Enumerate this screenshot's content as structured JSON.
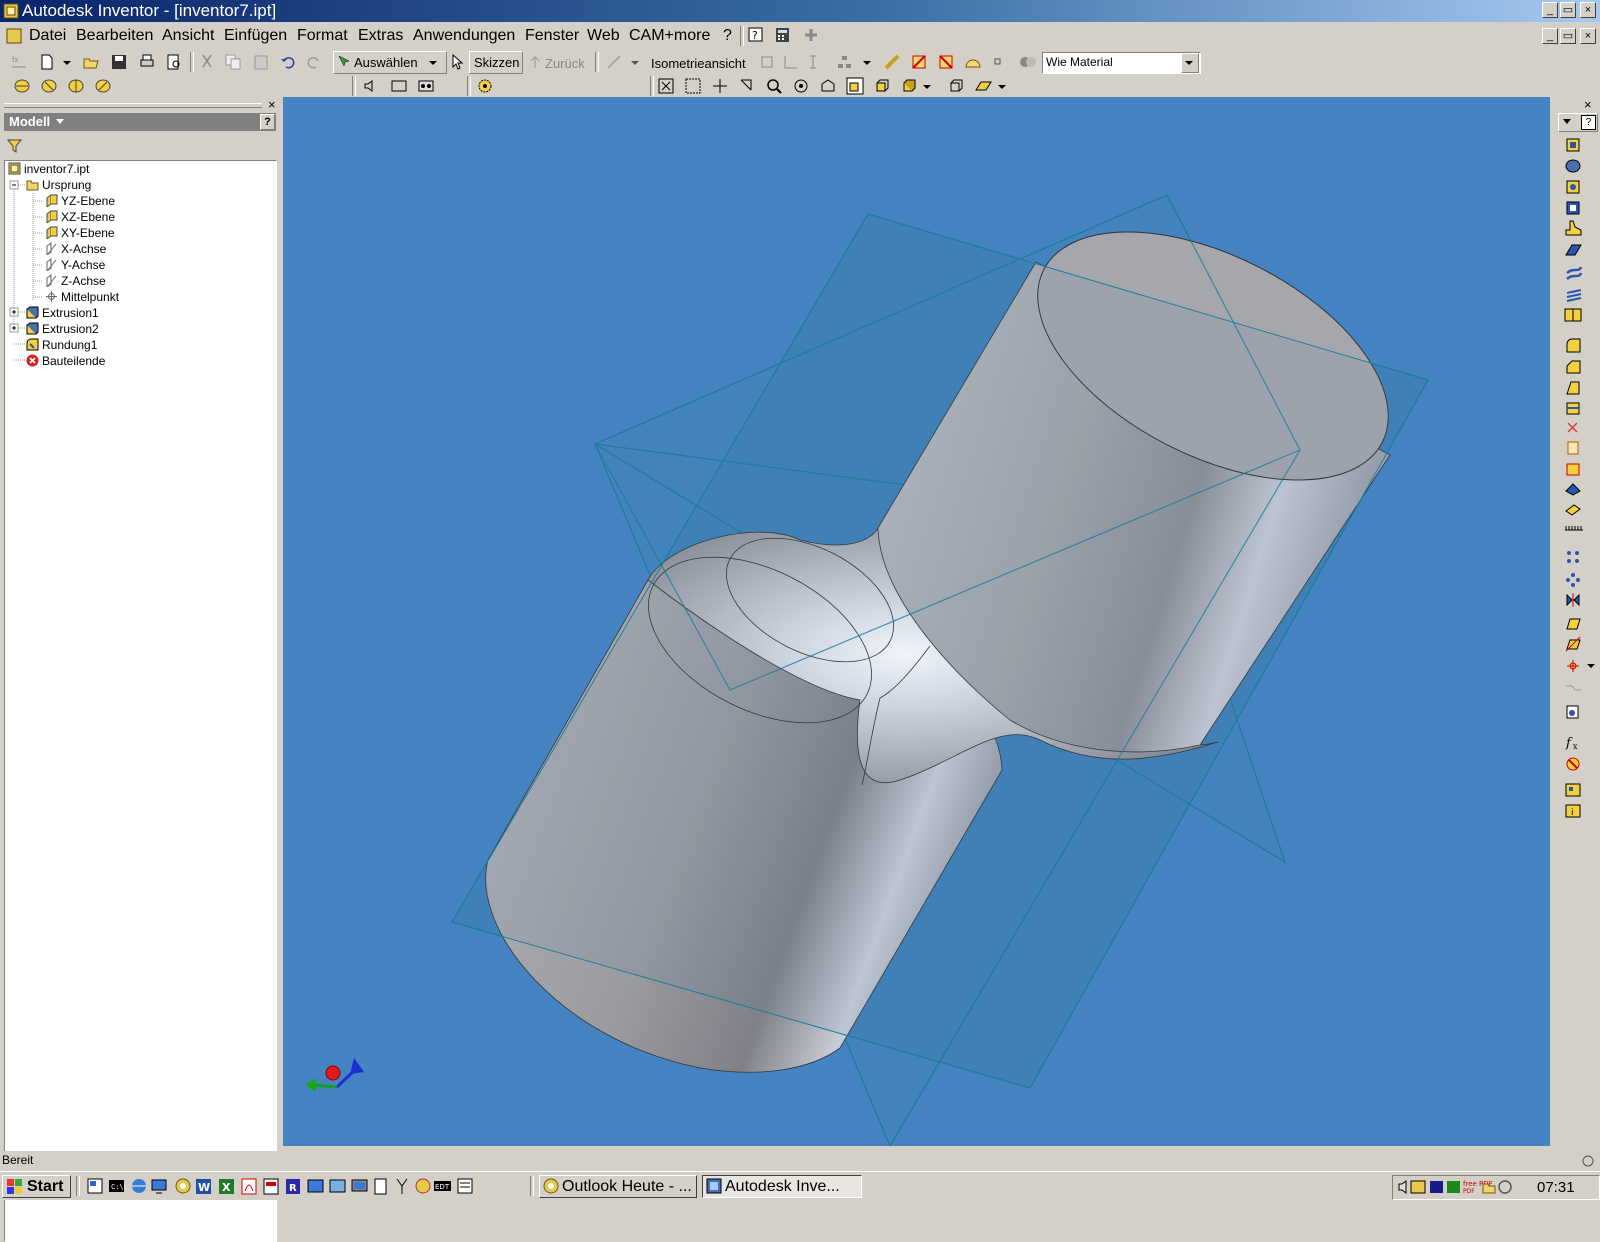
{
  "window": {
    "title": "Autodesk Inventor - [inventor7.ipt]",
    "buttons": [
      "_",
      "▭",
      "×"
    ]
  },
  "menu": {
    "items": [
      "Datei",
      "Bearbeiten",
      "Ansicht",
      "Einfügen",
      "Format",
      "Extras",
      "Anwendungen",
      "Fenster",
      "Web",
      "CAM+more",
      "?"
    ]
  },
  "toolbar": {
    "select_label": "Auswählen",
    "sketch_label": "Skizzen",
    "back_label": "Zurück",
    "view_label": "Isometrieansicht",
    "material_value": "Wie Material"
  },
  "browser": {
    "header": "Modell",
    "close": "×",
    "help": "?",
    "tree": [
      {
        "label": "inventor7.ipt",
        "icon": "part-icon"
      },
      {
        "label": "Ursprung",
        "icon": "folder-icon"
      },
      {
        "label": "YZ-Ebene",
        "icon": "plane-icon"
      },
      {
        "label": "XZ-Ebene",
        "icon": "plane-icon"
      },
      {
        "label": "XY-Ebene",
        "icon": "plane-icon"
      },
      {
        "label": "X-Achse",
        "icon": "axis-icon"
      },
      {
        "label": "Y-Achse",
        "icon": "axis-icon"
      },
      {
        "label": "Z-Achse",
        "icon": "axis-icon"
      },
      {
        "label": "Mittelpunkt",
        "icon": "point-icon"
      },
      {
        "label": "Extrusion1",
        "icon": "extrusion-icon"
      },
      {
        "label": "Extrusion2",
        "icon": "extrusion-icon"
      },
      {
        "label": "Rundung1",
        "icon": "fillet-icon"
      },
      {
        "label": "Bauteilende",
        "icon": "end-of-part-icon"
      }
    ]
  },
  "status": {
    "text": "Bereit"
  },
  "taskbar": {
    "start": "Start",
    "tasks": [
      "Outlook Heute - ...",
      "Autodesk Inve..."
    ],
    "clock": "07:31",
    "tray_label": "free PDF"
  },
  "colors": {
    "viewport_bg": "#4583c2",
    "titlebar": "#0a246a",
    "plane": "#3a7fb0"
  }
}
